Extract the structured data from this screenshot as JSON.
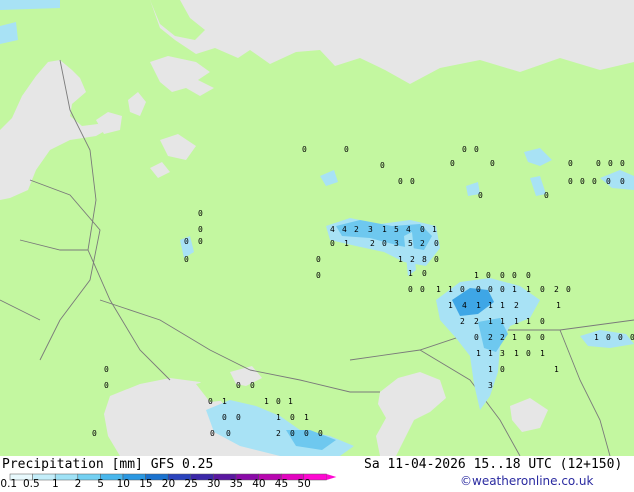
{
  "header": {
    "title": "Precipitation [mm]  GFS 0.25",
    "valid_time": "Sa 11-04-2026 15..18 UTC (12+150)",
    "credit": "©weatheronline.co.uk"
  },
  "colors": {
    "land": "#c3f7a0",
    "sea": "#e6e6e6",
    "border": "#7a7a7a",
    "precip_light": "#a8e2f5",
    "precip_mid": "#6ec8ef",
    "precip_heavy": "#3ea6e6"
  },
  "legend": {
    "ticks": [
      "0.1",
      "0.5",
      "1",
      "2",
      "5",
      "10",
      "15",
      "20",
      "25",
      "30",
      "35",
      "40",
      "45",
      "50"
    ],
    "colors": [
      "#e8f9fd",
      "#c4eefa",
      "#9fe2f6",
      "#73d0f2",
      "#48b6ec",
      "#2b98e2",
      "#1a72cf",
      "#2a43bd",
      "#3a27a8",
      "#5a17a0",
      "#8a0aa8",
      "#b806b0",
      "#e303c0",
      "#ff08d2"
    ]
  },
  "map_numbers": [
    {
      "t": "0"
    },
    {
      "t": "0"
    },
    {
      "t": "0"
    },
    {
      "t": "0"
    },
    {
      "t": "0"
    },
    {
      "t": "0"
    },
    {
      "t": "0"
    },
    {
      "t": "0"
    },
    {
      "t": "0"
    },
    {
      "t": "0"
    },
    {
      "t": "0"
    },
    {
      "t": "0"
    },
    {
      "t": "0"
    },
    {
      "t": "0"
    },
    {
      "t": "0"
    },
    {
      "t": "0"
    },
    {
      "t": "0"
    },
    {
      "t": "0"
    },
    {
      "t": "0"
    },
    {
      "t": "0"
    },
    {
      "t": "0"
    },
    {
      "t": "0"
    },
    {
      "t": "0"
    },
    {
      "t": "0"
    },
    {
      "t": "0"
    },
    {
      "t": "4"
    },
    {
      "t": "4"
    },
    {
      "t": "2"
    },
    {
      "t": "3"
    },
    {
      "t": "1"
    },
    {
      "t": "5"
    },
    {
      "t": "4"
    },
    {
      "t": "0"
    },
    {
      "t": "1"
    },
    {
      "t": "0"
    },
    {
      "t": "1"
    },
    {
      "t": "2"
    },
    {
      "t": "0"
    },
    {
      "t": "3"
    },
    {
      "t": "5"
    },
    {
      "t": "2"
    },
    {
      "t": "0"
    },
    {
      "t": "0"
    },
    {
      "t": "1"
    },
    {
      "t": "2"
    },
    {
      "t": "8"
    },
    {
      "t": "0"
    },
    {
      "t": "0"
    },
    {
      "t": "1"
    },
    {
      "t": "0"
    },
    {
      "t": "0"
    },
    {
      "t": "0"
    },
    {
      "t": "1"
    },
    {
      "t": "1"
    },
    {
      "t": "0"
    },
    {
      "t": "1"
    },
    {
      "t": "0"
    },
    {
      "t": "0"
    },
    {
      "t": "0"
    },
    {
      "t": "0"
    },
    {
      "t": "0"
    },
    {
      "t": "1"
    },
    {
      "t": "1"
    },
    {
      "t": "0"
    },
    {
      "t": "2"
    },
    {
      "t": "0"
    },
    {
      "t": "0"
    },
    {
      "t": "0"
    },
    {
      "t": "1"
    },
    {
      "t": "4"
    },
    {
      "t": "1"
    },
    {
      "t": "1"
    },
    {
      "t": "1"
    },
    {
      "t": "2"
    },
    {
      "t": "1"
    },
    {
      "t": "2"
    },
    {
      "t": "2"
    },
    {
      "t": "1"
    },
    {
      "t": "1"
    },
    {
      "t": "1"
    },
    {
      "t": "1"
    },
    {
      "t": "0"
    },
    {
      "t": "0"
    },
    {
      "t": "2"
    },
    {
      "t": "2"
    },
    {
      "t": "1"
    },
    {
      "t": "0"
    },
    {
      "t": "0"
    },
    {
      "t": "1"
    },
    {
      "t": "1"
    },
    {
      "t": "3"
    },
    {
      "t": "1"
    },
    {
      "t": "0"
    },
    {
      "t": "1"
    },
    {
      "t": "1"
    },
    {
      "t": "0"
    },
    {
      "t": "3"
    },
    {
      "t": "1"
    },
    {
      "t": "1"
    },
    {
      "t": "0"
    },
    {
      "t": "0"
    },
    {
      "t": "0"
    },
    {
      "t": "0"
    },
    {
      "t": "0"
    },
    {
      "t": "0"
    },
    {
      "t": "0"
    },
    {
      "t": "0"
    },
    {
      "t": "1"
    },
    {
      "t": "1"
    },
    {
      "t": "0"
    },
    {
      "t": "0"
    },
    {
      "t": "0"
    },
    {
      "t": "1"
    },
    {
      "t": "1"
    },
    {
      "t": "0"
    },
    {
      "t": "1"
    },
    {
      "t": "2"
    },
    {
      "t": "0"
    },
    {
      "t": "0"
    },
    {
      "t": "0"
    },
    {
      "t": "0"
    },
    {
      "t": "0"
    },
    {
      "t": "0"
    }
  ]
}
